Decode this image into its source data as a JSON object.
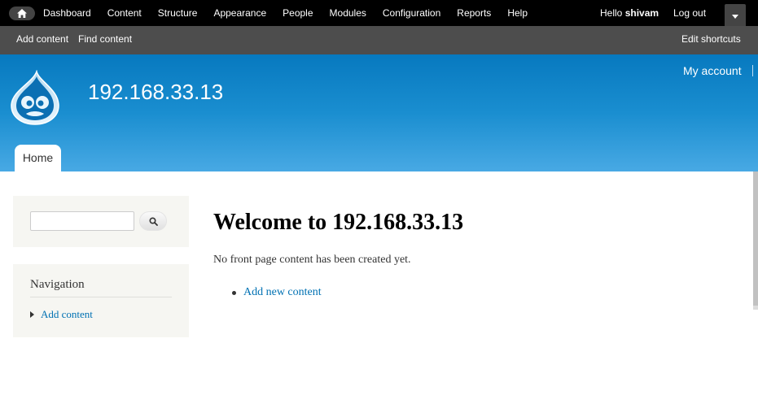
{
  "admin_toolbar": {
    "home_icon": "home-icon",
    "menu": [
      "Dashboard",
      "Content",
      "Structure",
      "Appearance",
      "People",
      "Modules",
      "Configuration",
      "Reports",
      "Help"
    ],
    "hello_prefix": "Hello ",
    "username": "shivam",
    "logout_label": "Log out",
    "toggle_icon": "chevron-down-icon"
  },
  "shortcuts": {
    "items": [
      "Add content",
      "Find content"
    ],
    "edit_label": "Edit shortcuts"
  },
  "header": {
    "logo_icon": "drupal-drop-logo",
    "site_name": "192.168.33.13",
    "my_account_label": "My account",
    "tabs": [
      "Home"
    ]
  },
  "sidebar": {
    "search": {
      "value": "",
      "button_icon": "search-icon"
    },
    "navigation": {
      "title": "Navigation",
      "items": [
        "Add content"
      ]
    }
  },
  "main": {
    "title": "Welcome to 192.168.33.13",
    "message": "No front page content has been created yet.",
    "links": [
      "Add new content"
    ]
  },
  "colors": {
    "admin_bar": "#000000",
    "shortcut_bar": "#4d4d4d",
    "header_top": "#0779bf",
    "header_bottom": "#48a9e4",
    "sidebar_block": "#f6f6f2",
    "link": "#0071b3"
  }
}
